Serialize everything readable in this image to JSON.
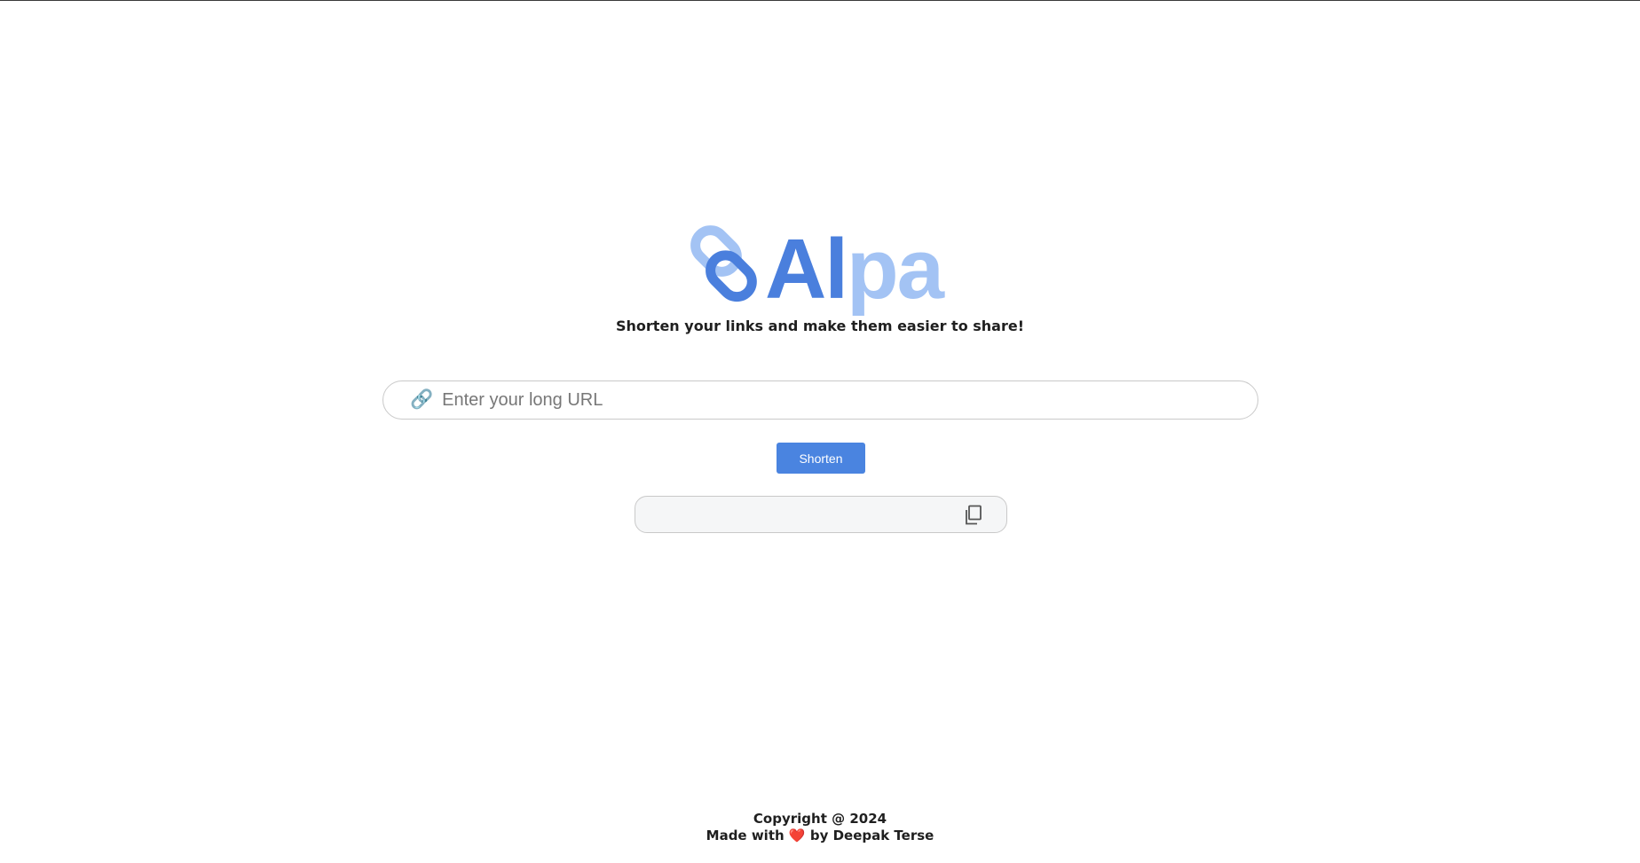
{
  "logo": {
    "text_part1": "Al",
    "text_part2": "pa",
    "icon": "chain-link-icon",
    "color_primary": "#4a7fdd",
    "color_secondary": "#a3c3f4"
  },
  "tagline": "Shorten your links and make them easier to share!",
  "url_input": {
    "icon": "🔗",
    "placeholder": "Enter your long URL",
    "value": ""
  },
  "shorten_button": {
    "label": "Shorten",
    "color": "#4a84e0"
  },
  "result": {
    "value": "",
    "copy_icon": "copy-icon"
  },
  "footer": {
    "copyright": "Copyright @ 2024",
    "made_with_prefix": "Made with",
    "heart": "❤️",
    "made_with_suffix": "by Deepak Terse"
  }
}
